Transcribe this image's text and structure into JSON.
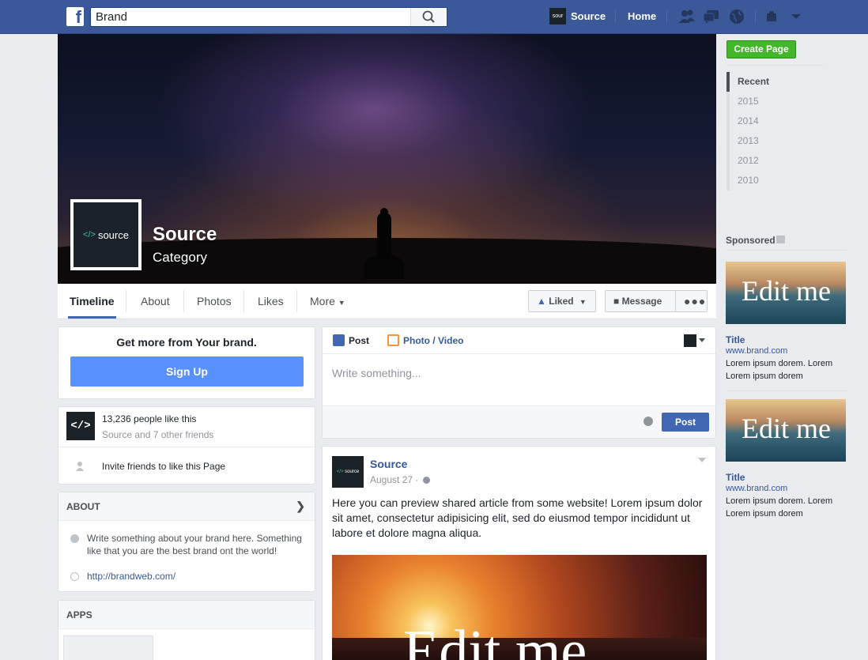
{
  "topbar": {
    "search_value": "Brand",
    "profile_name": "Source",
    "profile_avatar_text": "sour",
    "home_label": "Home",
    "icons": [
      "friends-icon",
      "messages-icon",
      "notifications-globe-icon",
      "settings-icon"
    ]
  },
  "cover": {
    "page_name": "Source",
    "category": "Category",
    "profile_logo_text": "source",
    "profile_logo_tag": "</>"
  },
  "tabs": {
    "timeline": "Timeline",
    "about": "About",
    "photos": "Photos",
    "likes": "Likes",
    "more": "More",
    "liked": "Liked",
    "message": "Message"
  },
  "getmore": {
    "title": "Get more from Your brand.",
    "signup": "Sign Up"
  },
  "likes": {
    "logo": "</>",
    "count": "13,236 people like this",
    "friends": "Source and 7 other friends",
    "invite": "Invite friends to like this Page"
  },
  "about": {
    "header": "ABOUT",
    "description": "Write something about your brand here. Something like that you are the best brand ont the world!",
    "link": "http://brandweb.com/"
  },
  "apps": {
    "header": "APPS"
  },
  "composer": {
    "post_tab": "Post",
    "photo_tab": "Photo / Video",
    "placeholder": "Write something...",
    "post_button": "Post"
  },
  "post": {
    "author": "Source",
    "date": "August 27 ·",
    "avatar_text": "source",
    "avatar_tag": "</>",
    "text": "Here you can preview shared article from some website! Lorem ipsum dolor sit amet, consectetur adipisicing elit, sed do eiusmod tempor incididunt ut labore et dolore magna aliqua.",
    "image_text": "Edit me"
  },
  "sidebar": {
    "create_page": "Create Page",
    "years": [
      "Recent",
      "2015",
      "2014",
      "2013",
      "2012",
      "2010"
    ],
    "sponsored": "Sponsored",
    "ads": [
      {
        "image_text": "Edit me",
        "title": "Title",
        "url": "www.brand.com",
        "body": "Lorem ipsum dorem. Lorem Lorem ipsum dorem"
      },
      {
        "image_text": "Edit me",
        "title": "Title",
        "url": "www.brand.com",
        "body": "Lorem ipsum dorem. Lorem Lorem ipsum dorem"
      }
    ]
  },
  "colors": {
    "brand_blue": "#3b5998",
    "link_blue": "#365899",
    "signup_blue": "#5890ff",
    "create_green": "#42b72a"
  }
}
